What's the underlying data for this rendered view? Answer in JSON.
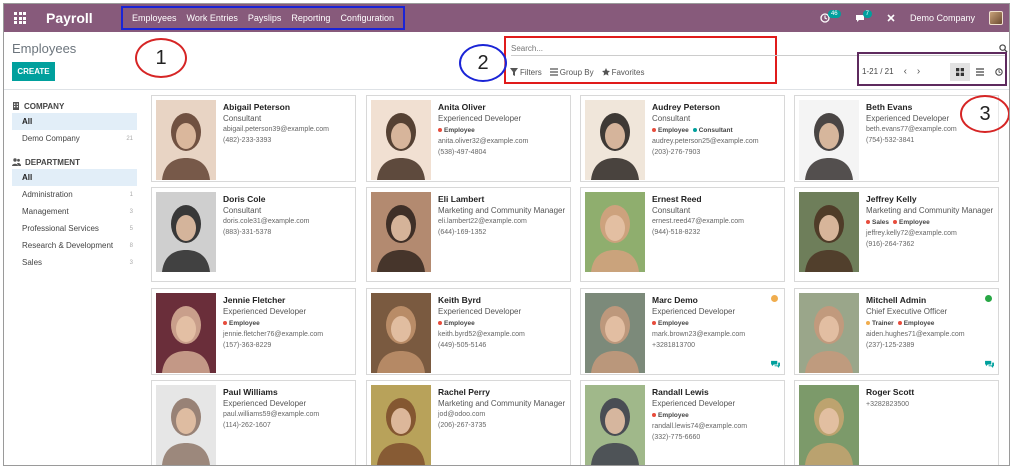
{
  "app": {
    "name": "Payroll"
  },
  "menu": [
    {
      "label": "Employees"
    },
    {
      "label": "Work Entries"
    },
    {
      "label": "Payslips"
    },
    {
      "label": "Reporting"
    },
    {
      "label": "Configuration"
    }
  ],
  "topright": {
    "activity_count": "46",
    "message_count": "7",
    "company": "Demo Company"
  },
  "controlpanel": {
    "title": "Employees",
    "create_label": "CREATE",
    "search_placeholder": "Search...",
    "filters_label": "Filters",
    "groupby_label": "Group By",
    "favorites_label": "Favorites",
    "pager": "1-21 / 21"
  },
  "annotations": [
    "1",
    "2",
    "3"
  ],
  "sidebar": {
    "company": {
      "heading": "COMPANY",
      "items": [
        {
          "label": "All",
          "count": ""
        },
        {
          "label": "Demo Company",
          "count": "21"
        }
      ]
    },
    "department": {
      "heading": "DEPARTMENT",
      "items": [
        {
          "label": "All",
          "count": ""
        },
        {
          "label": "Administration",
          "count": "1"
        },
        {
          "label": "Management",
          "count": "3"
        },
        {
          "label": "Professional Services",
          "count": "5"
        },
        {
          "label": "Research & Development",
          "count": "8"
        },
        {
          "label": "Sales",
          "count": "3"
        }
      ]
    }
  },
  "colors": {
    "brand": "#875a7b",
    "accent": "#00a09d",
    "tag_employee": "#e74c3c",
    "tag_consultant": "#00a09d",
    "tag_sales": "#e74c3c",
    "tag_trainer": "#f0ad4e",
    "status_away": "#f0ad4e",
    "status_online": "#28a745"
  },
  "employees": [
    {
      "name": "Abigail Peterson",
      "job": "Consultant",
      "tags": [],
      "email": "abigail.peterson39@example.com",
      "phone": "(482)-233-3393",
      "photo": [
        "#e8d4c4",
        "#5a3a2a"
      ]
    },
    {
      "name": "Anita Oliver",
      "job": "Experienced Developer",
      "tags": [
        "Employee"
      ],
      "email": "anita.oliver32@example.com",
      "phone": "(538)-497-4804",
      "photo": [
        "#f1e0d2",
        "#3a2418"
      ]
    },
    {
      "name": "Audrey Peterson",
      "job": "Consultant",
      "tags": [
        "Employee",
        "Consultant"
      ],
      "email": "audrey.peterson25@example.com",
      "phone": "(203)-276-7903",
      "photo": [
        "#f0e6da",
        "#1f1a17"
      ]
    },
    {
      "name": "Beth Evans",
      "job": "Experienced Developer",
      "tags": [],
      "email": "beth.evans77@example.com",
      "phone": "(754)-532-3841",
      "photo": [
        "#f4f4f4",
        "#2a2624"
      ]
    },
    {
      "name": "Doris Cole",
      "job": "Consultant",
      "tags": [],
      "email": "doris.cole31@example.com",
      "phone": "(883)-331-5378",
      "photo": [
        "#cfcfcf",
        "#1d1d1d"
      ]
    },
    {
      "name": "Eli Lambert",
      "job": "Marketing and Community Manager",
      "tags": [],
      "email": "eli.lambert22@example.com",
      "phone": "(644)-169-1352",
      "photo": [
        "#b38a70",
        "#2a1f1a"
      ]
    },
    {
      "name": "Ernest Reed",
      "job": "Consultant",
      "tags": [],
      "email": "ernest.reed47@example.com",
      "phone": "(944)-518-8232",
      "photo": [
        "#8fae6e",
        "#d8a080"
      ]
    },
    {
      "name": "Jeffrey Kelly",
      "job": "Marketing and Community Manager",
      "tags": [
        "Sales",
        "Employee"
      ],
      "email": "jeffrey.kelly72@example.com",
      "phone": "(916)-264-7362",
      "photo": [
        "#6e7e5a",
        "#4a3020"
      ]
    },
    {
      "name": "Jennie Fletcher",
      "job": "Experienced Developer",
      "tags": [
        "Employee"
      ],
      "email": "jennie.fletcher76@example.com",
      "phone": "(157)-363-8229",
      "photo": [
        "#6a2e3a",
        "#d9b39a"
      ]
    },
    {
      "name": "Keith Byrd",
      "job": "Experienced Developer",
      "tags": [
        "Employee"
      ],
      "email": "keith.byrd52@example.com",
      "phone": "(449)-505-5146",
      "photo": [
        "#7a5a40",
        "#c4956e"
      ]
    },
    {
      "name": "Marc Demo",
      "job": "Experienced Developer",
      "tags": [
        "Employee"
      ],
      "email": "mark.brown23@example.com",
      "phone": "+3281813700",
      "photo": [
        "#7c8a7a",
        "#c99a7c"
      ],
      "status": "away",
      "chat": true
    },
    {
      "name": "Mitchell Admin",
      "job": "Chief Executive Officer",
      "tags": [
        "Trainer",
        "Employee"
      ],
      "email": "aiden.hughes71@example.com",
      "phone": "(237)-125-2389",
      "photo": [
        "#9aa68a",
        "#c8987a"
      ],
      "status": "online",
      "chat": true
    },
    {
      "name": "Paul Williams",
      "job": "Experienced Developer",
      "tags": [],
      "email": "paul.williams59@example.com",
      "phone": "(114)-262-1607",
      "photo": [
        "#e6e6e6",
        "#8a7062"
      ]
    },
    {
      "name": "Rachel Perry",
      "job": "Marketing and Community Manager",
      "tags": [],
      "email": "jod@odoo.com",
      "phone": "(206)-267-3735",
      "photo": [
        "#b8a25a",
        "#7a4a2a"
      ]
    },
    {
      "name": "Randall Lewis",
      "job": "Experienced Developer",
      "tags": [
        "Employee"
      ],
      "email": "randall.lewis74@example.com",
      "phone": "(332)-775-6660",
      "photo": [
        "#a0b88a",
        "#3a3a4a"
      ]
    },
    {
      "name": "Roger Scott",
      "job": "",
      "tags": [],
      "email": "",
      "phone": "+3282823500",
      "photo": [
        "#7c9a6a",
        "#c9a470"
      ]
    }
  ]
}
